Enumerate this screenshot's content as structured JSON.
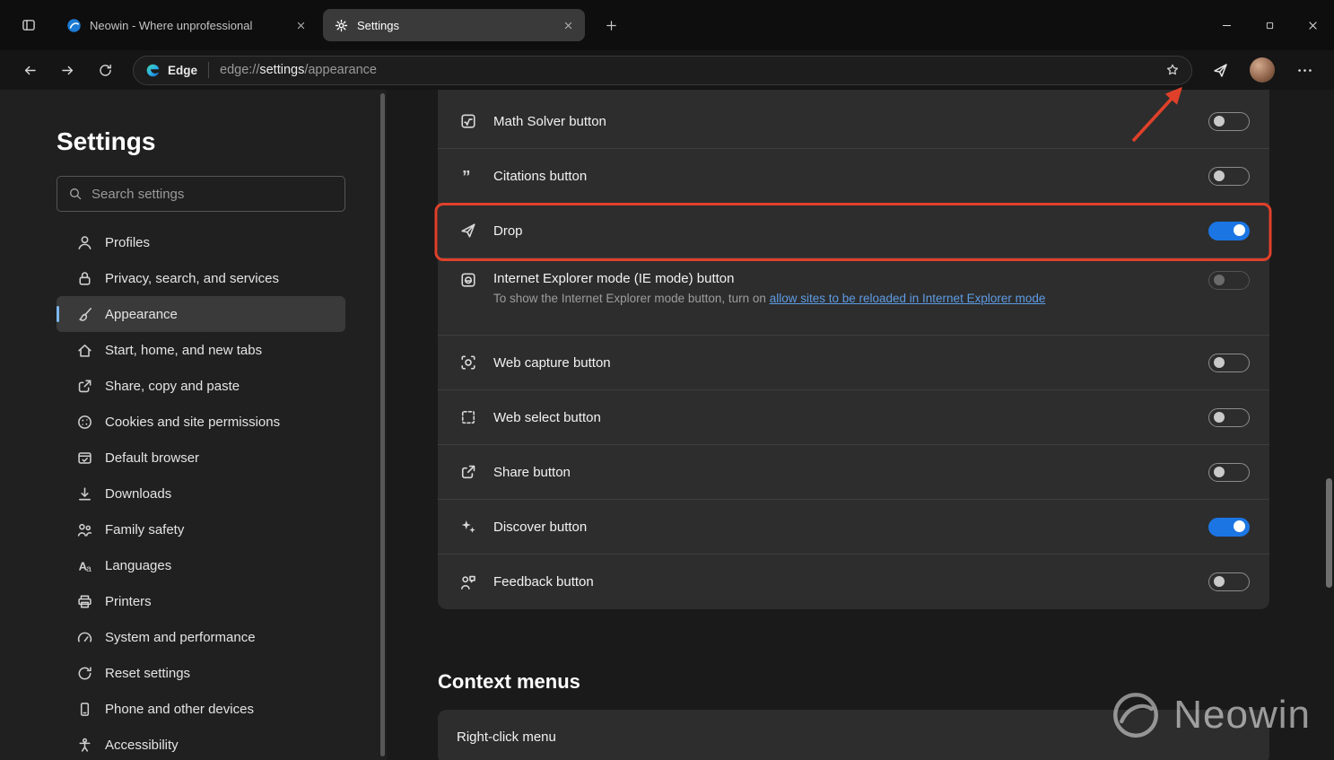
{
  "tab_bar": {
    "tabs": [
      {
        "title": "Neowin - Where unprofessional",
        "favicon": "neowin-favicon",
        "active": false
      },
      {
        "title": "Settings",
        "favicon": "gear",
        "active": true
      }
    ]
  },
  "nav": {
    "site_label": "Edge",
    "url": {
      "scheme": "edge://",
      "host": "settings",
      "path": "/appearance"
    }
  },
  "sidebar": {
    "title": "Settings",
    "search_placeholder": "Search settings",
    "items": [
      {
        "label": "Profiles",
        "icon": "person"
      },
      {
        "label": "Privacy, search, and services",
        "icon": "lock"
      },
      {
        "label": "Appearance",
        "icon": "brush",
        "selected": true
      },
      {
        "label": "Start, home, and new tabs",
        "icon": "home"
      },
      {
        "label": "Share, copy and paste",
        "icon": "share"
      },
      {
        "label": "Cookies and site permissions",
        "icon": "cookie"
      },
      {
        "label": "Default browser",
        "icon": "browser-check"
      },
      {
        "label": "Downloads",
        "icon": "download"
      },
      {
        "label": "Family safety",
        "icon": "family"
      },
      {
        "label": "Languages",
        "icon": "language"
      },
      {
        "label": "Printers",
        "icon": "printer"
      },
      {
        "label": "System and performance",
        "icon": "gauge"
      },
      {
        "label": "Reset settings",
        "icon": "reset"
      },
      {
        "label": "Phone and other devices",
        "icon": "phone"
      },
      {
        "label": "Accessibility",
        "icon": "accessibility"
      }
    ]
  },
  "content": {
    "toolbar_rows": [
      {
        "label": "Math Solver button",
        "icon": "math",
        "toggle": false
      },
      {
        "label": "Citations button",
        "icon": "quote",
        "toggle": false
      },
      {
        "label": "Drop",
        "icon": "send",
        "toggle": true,
        "highlighted": true
      },
      {
        "label": "Internet Explorer mode (IE mode) button",
        "icon": "ie",
        "toggle": false,
        "disabled": true,
        "description_prefix": "To show the Internet Explorer mode button, turn on ",
        "description_link": "allow sites to be reloaded in Internet Explorer mode"
      },
      {
        "label": "Web capture button",
        "icon": "capture",
        "toggle": false
      },
      {
        "label": "Web select button",
        "icon": "select",
        "toggle": false
      },
      {
        "label": "Share button",
        "icon": "share",
        "toggle": false
      },
      {
        "label": "Discover button",
        "icon": "sparkle",
        "toggle": true
      },
      {
        "label": "Feedback button",
        "icon": "feedback",
        "toggle": false
      }
    ],
    "section_heading": "Context menus",
    "context_rows": [
      {
        "label": "Right-click menu"
      }
    ]
  },
  "watermark": {
    "text": "Neowin"
  },
  "colors": {
    "accent_blue": "#1b76e4",
    "annotation_red": "#e0402a",
    "link_blue": "#5e9ce4",
    "card_bg": "#2d2d2d"
  }
}
